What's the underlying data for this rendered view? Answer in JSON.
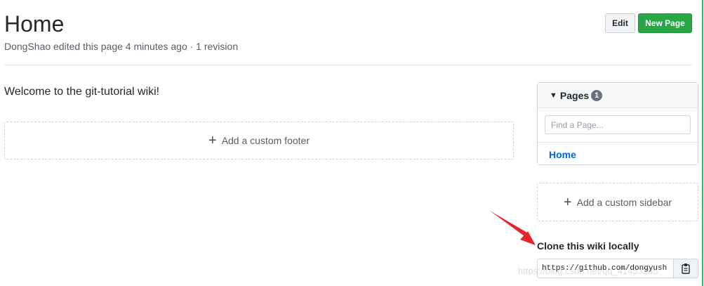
{
  "header": {
    "title": "Home",
    "meta": "DongShao edited this page 4 minutes ago · 1 revision",
    "edit_label": "Edit",
    "new_page_label": "New Page"
  },
  "content": {
    "welcome": "Welcome to the git-tutorial wiki!",
    "add_footer": "Add a custom footer"
  },
  "pages_panel": {
    "title": "Pages",
    "count": "1",
    "find_placeholder": "Find a Page...",
    "pages": [
      "Home"
    ]
  },
  "sidebar": {
    "add_sidebar": "Add a custom sidebar"
  },
  "clone": {
    "label": "Clone this wiki locally",
    "url": "https://github.com/dongyush"
  },
  "colors": {
    "primary_button": "#28a745",
    "link": "#0366d6",
    "annotation_arrow": "#e4262c"
  },
  "icons": [
    "plus-icon",
    "triangle-down-icon",
    "clippy-icon"
  ],
  "watermark": "https://blog.csdn.net/qq_41453285"
}
